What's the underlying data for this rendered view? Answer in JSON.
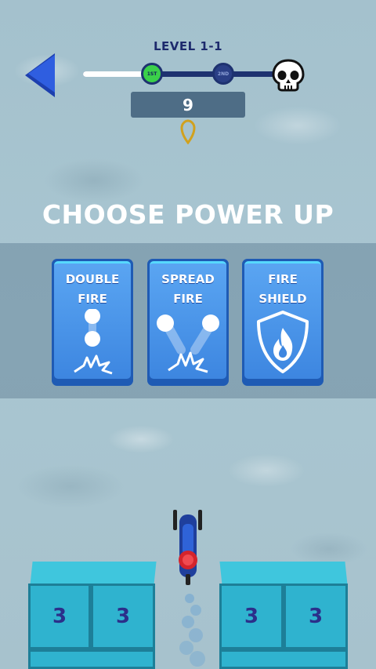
{
  "hud": {
    "level_label": "LEVEL 1-1",
    "progress": 0.4,
    "stage_nodes": [
      {
        "label": "1ST",
        "state": "complete"
      },
      {
        "label": "2ND",
        "state": "locked"
      }
    ],
    "boss_icon": "skull-icon",
    "score": "9"
  },
  "power_up_screen": {
    "title": "CHOOSE POWER UP",
    "cards": [
      {
        "label_line1": "DOUBLE",
        "label_line2": "FIRE",
        "icon": "double-fire-icon"
      },
      {
        "label_line1": "SPREAD",
        "label_line2": "FIRE",
        "icon": "spread-fire-icon"
      },
      {
        "label_line1": "FIRE",
        "label_line2": "SHIELD",
        "icon": "fire-shield-icon"
      }
    ]
  },
  "scene": {
    "blocks": [
      "3",
      "3",
      "3",
      "3"
    ]
  },
  "colors": {
    "background": "#a9c4cf",
    "accent_blue": "#3d86e0",
    "progress_track": "#1e3270",
    "complete_node": "#3bd04a",
    "block": "#2fb3cf"
  }
}
